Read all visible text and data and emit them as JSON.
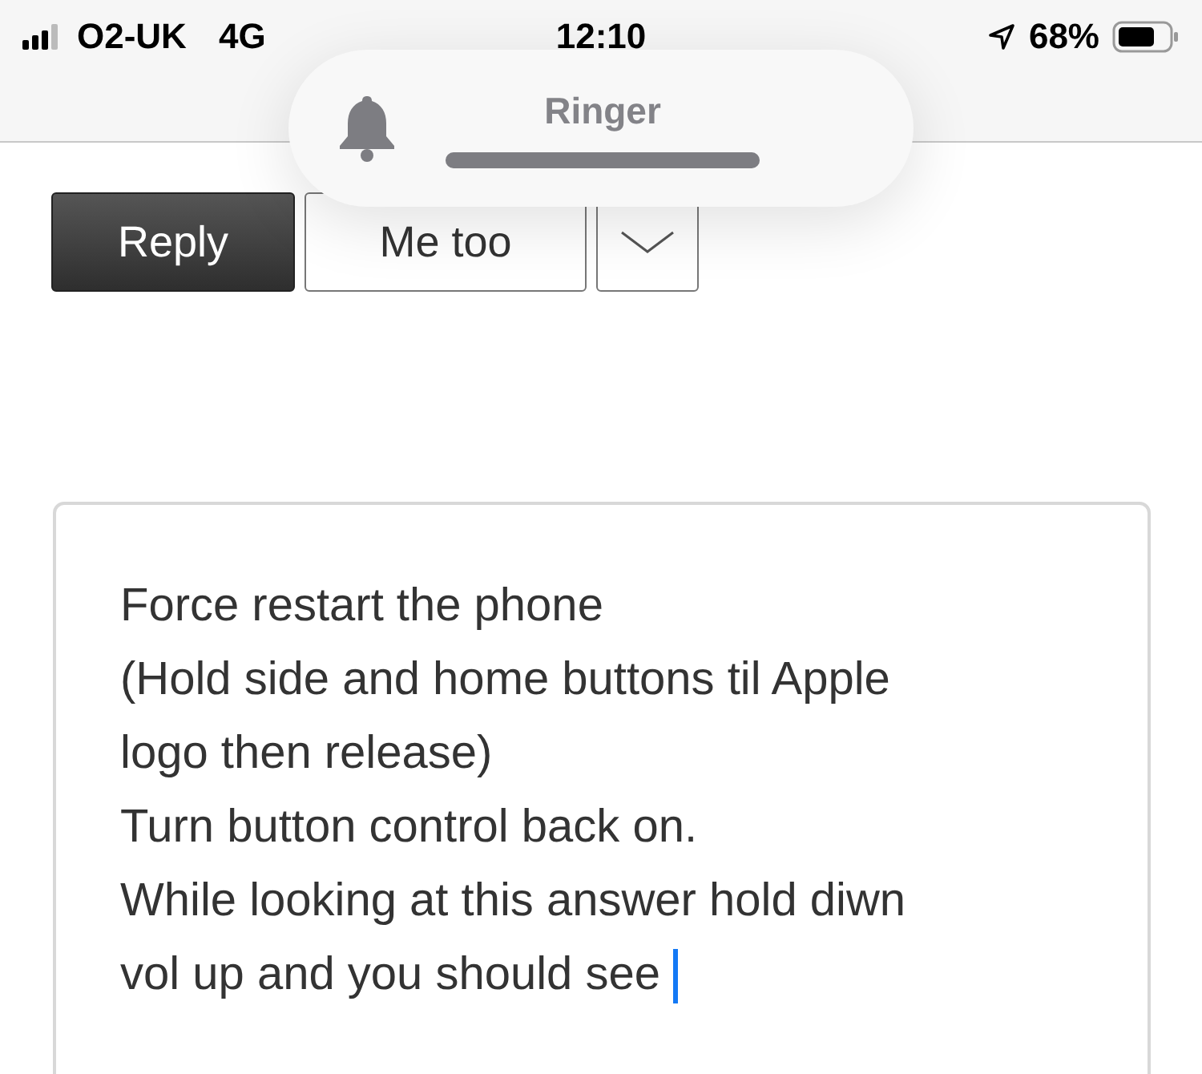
{
  "status_bar": {
    "carrier": "O2-UK",
    "network": "4G",
    "time": "12:10",
    "battery": "68%"
  },
  "ringer_hud": {
    "title": "Ringer",
    "level": 1
  },
  "buttons": [
    {
      "label": "Reply",
      "kind": "primary"
    },
    {
      "label": "Me too",
      "kind": "secondary"
    },
    {
      "kind": "dropdown"
    }
  ],
  "editor": {
    "lines": [
      "Force restart the phone",
      "(Hold side and home buttons til Apple",
      "logo then release)",
      "Turn button control back on.",
      "While looking at this answer hold diwn",
      "vol up and you should see"
    ]
  }
}
